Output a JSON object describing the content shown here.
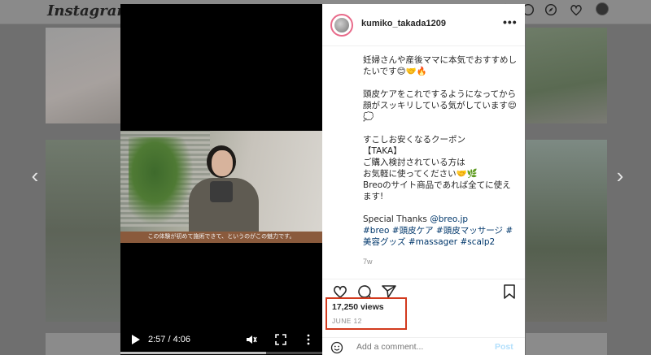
{
  "background": {
    "logo": "Instagram",
    "nav_icons": [
      "home-icon",
      "direct-icon",
      "explore-icon",
      "heart-icon"
    ]
  },
  "video": {
    "subtitle": "この体験が初めて施術できて、というのがこの魅力です。",
    "time": "2:57 / 4:06",
    "progress": 0.72
  },
  "post": {
    "username": "kumiko_takada1209",
    "more": "•••",
    "caption": {
      "p1": "妊婦さんや産後ママに本気でおすすめしたいです😊🤝🔥",
      "p2": "頭皮ケアをこれでするようになってから顔がスッキリしている気がしています😌💭",
      "p3": "すこしお安くなるクーポン\n【TAKA】\nご購入検討されている方は\nお気軽に使ってください🤝🌿\nBreoのサイト商品であれば全てに使えます!",
      "thanks_prefix": "Special Thanks ",
      "thanks_mention": "@breo.jp",
      "hashtags": "#breo #頭皮ケア #頭皮マッサージ #美容グッズ #massager #scalp2"
    },
    "age": "7w",
    "views": "17,250 views",
    "date": "JUNE 12",
    "comment_placeholder": "Add a comment...",
    "post_button": "Post"
  }
}
